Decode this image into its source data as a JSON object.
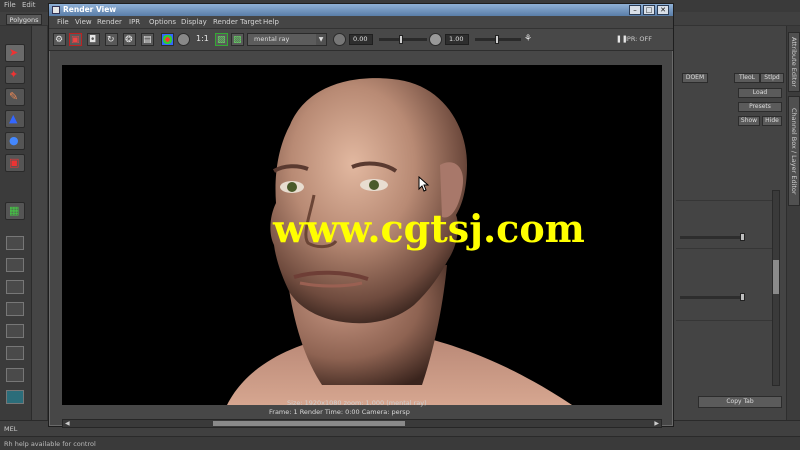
{
  "maya": {
    "menus": [
      "File",
      "Edit"
    ],
    "shelf_tab": "Polygons",
    "help_line": "Rh help available for control",
    "cmd_label": "MEL",
    "right_panel": {
      "buttons": [
        "Load",
        "Presets",
        "Show",
        "Hide",
        "Copy Tab"
      ],
      "fields": [
        "TleoL",
        "Stlpd",
        "DOEM"
      ],
      "side_tabs": [
        "Attribute Editor",
        "Channel Box / Layer Editor"
      ]
    }
  },
  "render_view": {
    "title": "Render View",
    "menus": [
      "File",
      "View",
      "Render",
      "IPR",
      "Options",
      "Display",
      "Render Target",
      "Help"
    ],
    "renderer": "mental ray",
    "exposure": "0.00",
    "gamma": "1.00",
    "ipr_label": "IPR: OFF",
    "zoom_label": "1:1",
    "stats_line1": "Size: 1920x1080  zoom: 1.000    (mental ray)",
    "stats_line2": "Frame: 1    Render Time: 0:00    Camera: persp",
    "watermark": "www.cgtsj.com",
    "icons": [
      "render-frame-icon",
      "render-region-icon",
      "snapshot-icon",
      "redo-render-icon",
      "ipr-icon",
      "refresh-icon",
      "rgb-channels-icon",
      "alpha-channel-icon",
      "zoom-1to1-icon",
      "keep-image-icon",
      "remove-image-icon"
    ]
  }
}
